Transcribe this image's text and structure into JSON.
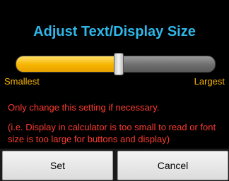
{
  "dialog": {
    "title": "Adjust Text/Display Size",
    "slider": {
      "value_fraction": 0.52,
      "min_label": "Smallest",
      "max_label": "Largest"
    },
    "note_line": "Only change this setting if necessary.",
    "note_detail": "(i.e. Display in calculator is too small to read or font size is too large for buttons and display)",
    "buttons": {
      "set": "Set",
      "cancel": "Cancel"
    }
  },
  "colors": {
    "title": "#2fb8ea",
    "accent": "#f6b400",
    "warning": "#ff3b2f"
  }
}
